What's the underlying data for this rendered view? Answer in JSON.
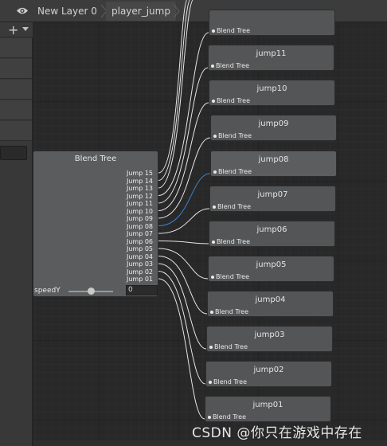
{
  "breadcrumb": {
    "layer": "New Layer 0",
    "state": "player_jump"
  },
  "main_node": {
    "title": "Blend Tree",
    "ports": [
      "Jump 15",
      "Jump 14",
      "Jump 13",
      "Jump 12",
      "Jump 11",
      "Jump 10",
      "Jump 09",
      "Jump 08",
      "Jump 07",
      "Jump 06",
      "Jump 05",
      "Jump 04",
      "Jump 03",
      "Jump 02",
      "Jump 01"
    ],
    "parameter": "speedY",
    "value": "0",
    "slider_fraction": 0.5
  },
  "child_nodes": [
    {
      "title": "jump11",
      "subtitle": "Blend Tree"
    },
    {
      "title": "jump10",
      "subtitle": "Blend Tree"
    },
    {
      "title": "jump09",
      "subtitle": "Blend Tree"
    },
    {
      "title": "jump08",
      "subtitle": "Blend Tree"
    },
    {
      "title": "jump07",
      "subtitle": "Blend Tree"
    },
    {
      "title": "jump06",
      "subtitle": "Blend Tree"
    },
    {
      "title": "jump05",
      "subtitle": "Blend Tree"
    },
    {
      "title": "jump04",
      "subtitle": "Blend Tree"
    },
    {
      "title": "jump03",
      "subtitle": "Blend Tree"
    },
    {
      "title": "jump02",
      "subtitle": "Blend Tree"
    },
    {
      "title": "jump01",
      "subtitle": "Blend Tree"
    }
  ],
  "partial_top_node": {
    "subtitle": "Blend Tree"
  },
  "selected_node": "jump08",
  "icons": {
    "visibility": "eye-icon",
    "add": "plus-icon",
    "add_menu": "caret-down-icon",
    "separator": "chevron-right-icon"
  },
  "colors": {
    "wire": "#e6e6e6",
    "wire_highlight": "#3d7fc4",
    "node": "#535557",
    "main_node": "#5a5c5e"
  },
  "watermark": "CSDN @你只在游戏中存在"
}
